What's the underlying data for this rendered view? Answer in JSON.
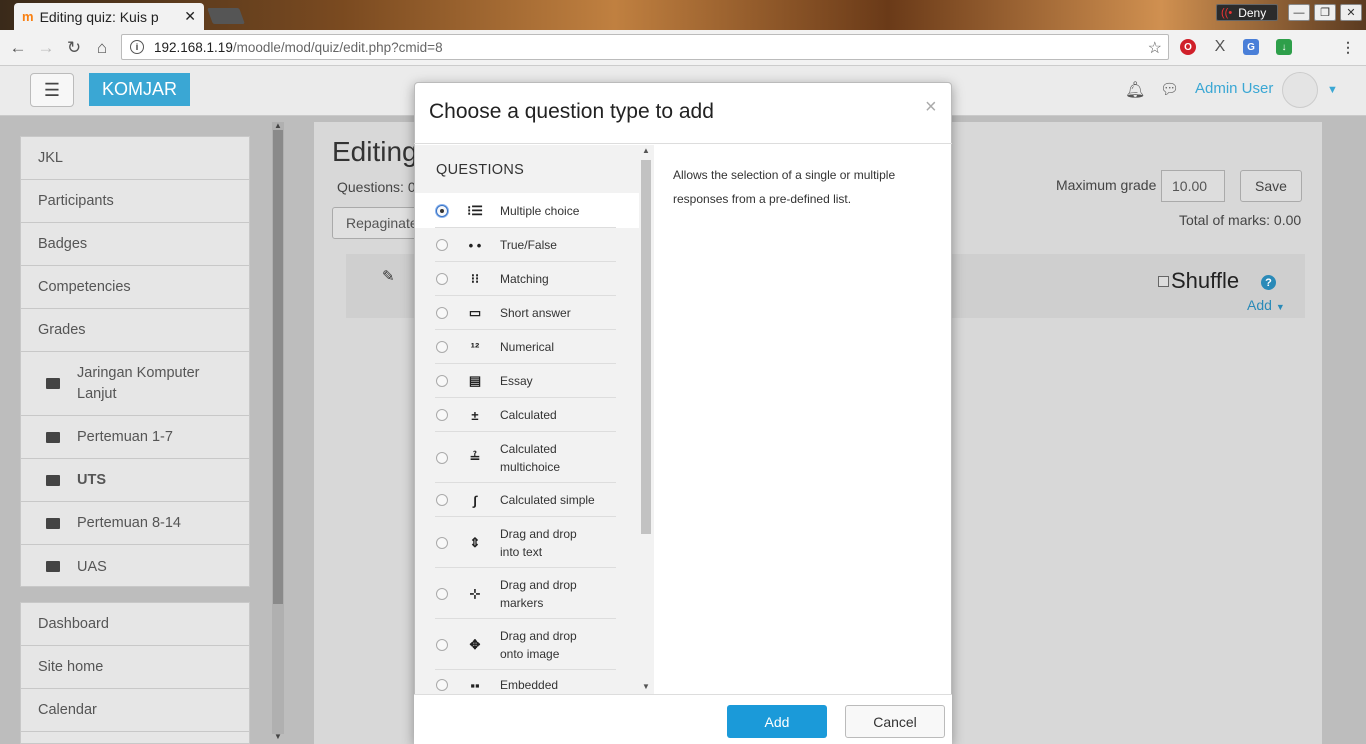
{
  "browser": {
    "tab_title": "Editing quiz: Kuis p",
    "tab_favicon": "m",
    "deny_label": "Deny",
    "url_host": "192.168.1.19",
    "url_path": "/moodle/mod/quiz/edit.php?cmid=8"
  },
  "navbar": {
    "brand": "KOMJAR",
    "user_name": "Admin User"
  },
  "sidebar": {
    "course_items": [
      {
        "label": "JKL"
      },
      {
        "label": "Participants"
      },
      {
        "label": "Badges"
      },
      {
        "label": "Competencies"
      },
      {
        "label": "Grades"
      }
    ],
    "folders": [
      {
        "label": "Jaringan Komputer Lanjut"
      },
      {
        "label": "Pertemuan 1-7"
      },
      {
        "label": "UTS"
      },
      {
        "label": "Pertemuan 8-14"
      },
      {
        "label": "UAS"
      }
    ],
    "site_items": [
      {
        "label": "Dashboard"
      },
      {
        "label": "Site home"
      },
      {
        "label": "Calendar"
      }
    ]
  },
  "main": {
    "title": "Editing",
    "questions_label": "Questions: 0",
    "repaginate_label": "Repaginate",
    "max_grade_label": "Maximum grade",
    "max_grade_value": "10.00",
    "save_label": "Save",
    "total_marks": "Total of marks: 0.00",
    "shuffle_label": "Shuffle",
    "help_symbol": "?",
    "add_label": "Add"
  },
  "modal": {
    "title": "Choose a question type to add",
    "close_symbol": "×",
    "section_header": "QUESTIONS",
    "options": [
      {
        "label": "Multiple choice",
        "icon": "list-bullets-icon",
        "selected": true
      },
      {
        "label": "True/False",
        "icon": "two-dots-icon",
        "selected": false
      },
      {
        "label": "Matching",
        "icon": "matching-icon",
        "selected": false
      },
      {
        "label": "Short answer",
        "icon": "short-answer-icon",
        "selected": false
      },
      {
        "label": "Numerical",
        "icon": "numerical-icon",
        "selected": false
      },
      {
        "label": "Essay",
        "icon": "essay-icon",
        "selected": false
      },
      {
        "label": "Calculated",
        "icon": "calculated-icon",
        "selected": false
      },
      {
        "label": "Calculated\nmultichoice",
        "icon": "calculated-multichoice-icon",
        "selected": false
      },
      {
        "label": "Calculated simple",
        "icon": "calculated-simple-icon",
        "selected": false
      },
      {
        "label": "Drag and drop\ninto text",
        "icon": "drag-drop-text-icon",
        "selected": false
      },
      {
        "label": "Drag and drop\nmarkers",
        "icon": "drag-drop-markers-icon",
        "selected": false
      },
      {
        "label": "Drag and drop\nonto image",
        "icon": "drag-drop-image-icon",
        "selected": false
      },
      {
        "label": "Embedded",
        "icon": "embedded-icon",
        "selected": false
      }
    ],
    "description": "Allows the selection of a single or multiple responses from a pre-defined list.",
    "add_button": "Add",
    "cancel_button": "Cancel"
  }
}
